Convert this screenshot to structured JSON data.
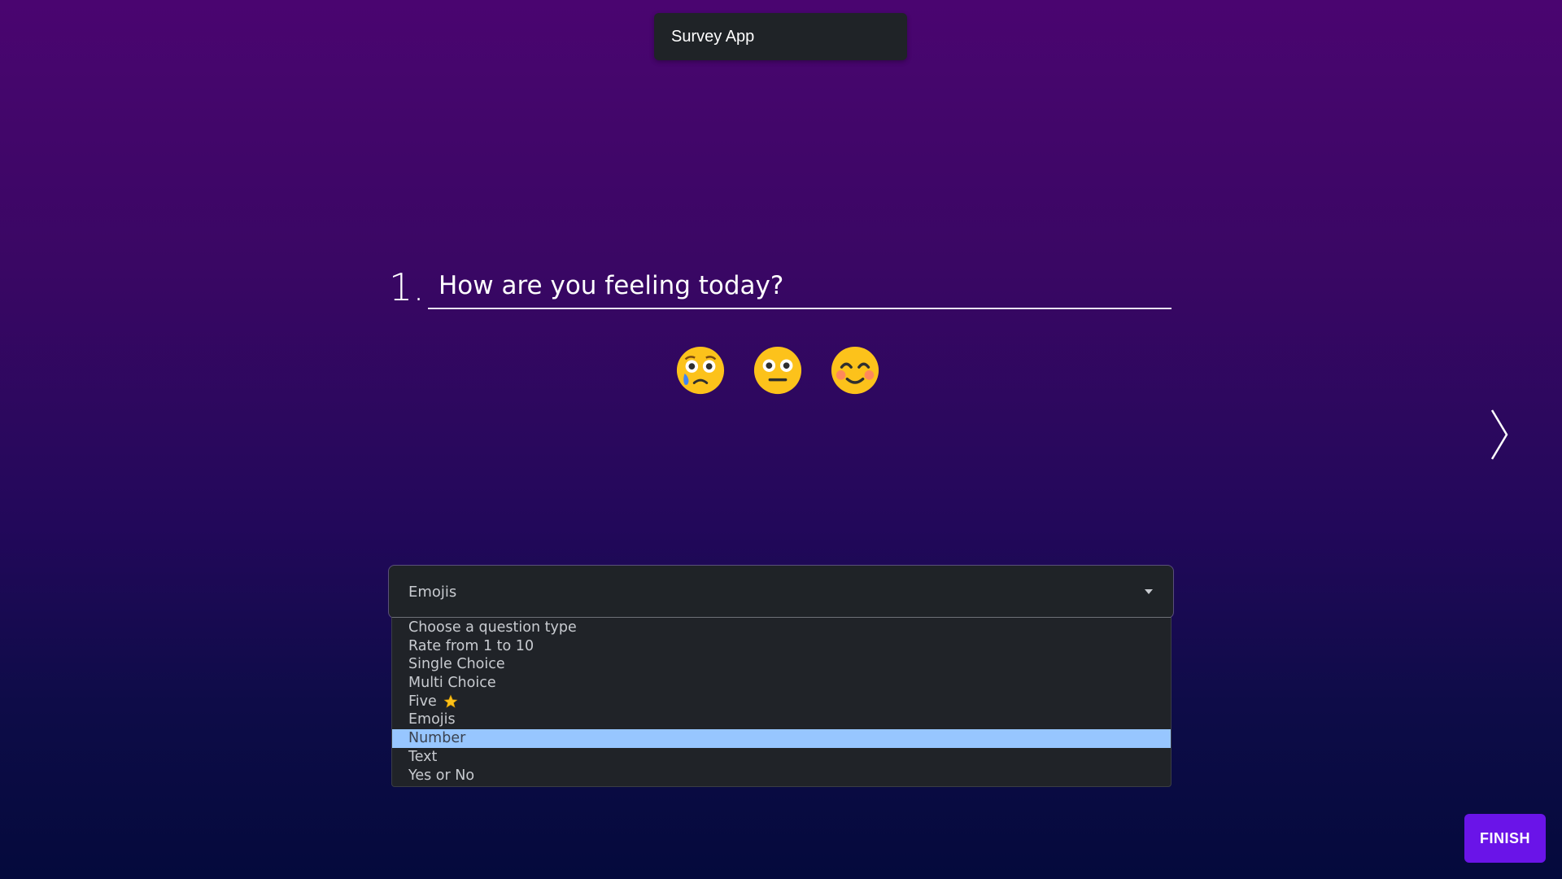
{
  "app": {
    "title": "Survey App"
  },
  "question": {
    "number": "1.",
    "text": "How are you feeling today?",
    "emojis": [
      "crying-face",
      "neutral-face",
      "smiling-face"
    ]
  },
  "question_type": {
    "selected": "Emojis",
    "options": [
      "Choose a question type",
      "Rate from 1 to 10",
      "Single Choice",
      "Multi Choice",
      "Five",
      "Emojis",
      "Number",
      "Text",
      "Yes or No"
    ],
    "highlighted": "Number"
  },
  "actions": {
    "finish_label": "FINISH"
  },
  "colors": {
    "accent": "#6a14e8",
    "highlight": "#97c6ff",
    "panel": "#1f2327"
  }
}
